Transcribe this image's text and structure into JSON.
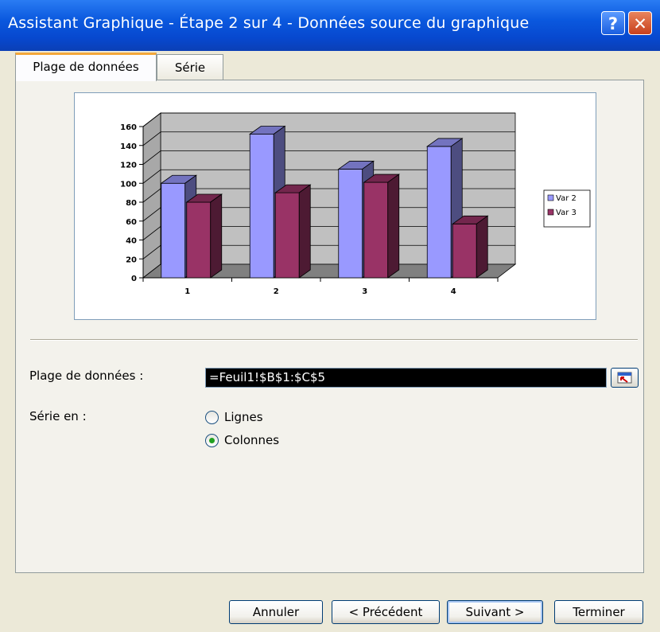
{
  "window": {
    "title": "Assistant Graphique - Étape 2 sur 4 - Données source du graphique",
    "help_label": "?",
    "close_label": "✕"
  },
  "tabs": [
    {
      "label": "Plage de données",
      "active": true
    },
    {
      "label": "Série",
      "active": false
    }
  ],
  "chart_data": {
    "type": "bar",
    "categories": [
      "1",
      "2",
      "3",
      "4"
    ],
    "series": [
      {
        "name": "Var 2",
        "values": [
          100,
          152,
          115,
          139
        ],
        "color": "#9999ff"
      },
      {
        "name": "Var 3",
        "values": [
          80,
          90,
          101,
          57
        ],
        "color": "#993366"
      }
    ],
    "ylim": [
      0,
      160
    ],
    "yticks": [
      "0",
      "20",
      "40",
      "60",
      "80",
      "100",
      "120",
      "140",
      "160"
    ],
    "grid": true,
    "legend": "right",
    "three_d": true
  },
  "form": {
    "range_label": "Plage de données :",
    "range_value": "=Feuil1!$B$1:$C$5",
    "series_in_label": "Série en :",
    "radio_rows": "Lignes",
    "radio_columns": "Colonnes",
    "selected": "Colonnes"
  },
  "buttons": {
    "cancel": "Annuler",
    "previous": "< Précédent",
    "next": "Suivant >",
    "finish": "Terminer"
  }
}
